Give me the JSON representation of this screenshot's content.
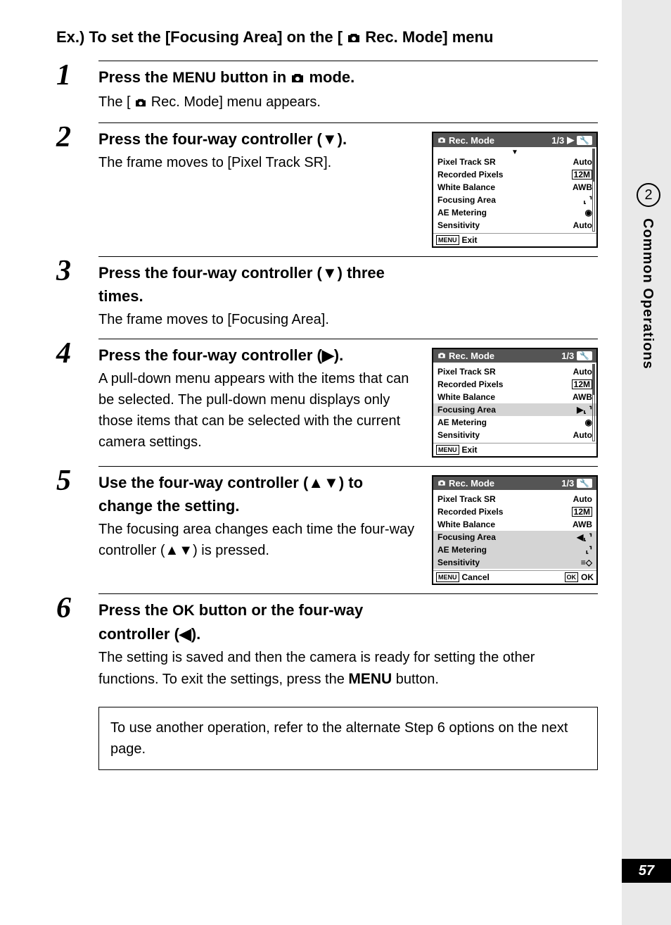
{
  "rail": {
    "chapter": "2",
    "title": "Common Operations",
    "page": "57"
  },
  "title": {
    "pre": "Ex.) To set the [Focusing Area] on the [",
    "post": " Rec. Mode] menu"
  },
  "steps": [
    {
      "num": "1",
      "head": {
        "a": "Press the ",
        "b": "MENU",
        "c": " button in ",
        "d": " mode."
      },
      "desc": {
        "a": "The [",
        "b": " Rec. Mode] menu appears."
      }
    },
    {
      "num": "2",
      "head": "Press the four-way controller (▼).",
      "desc": "The frame moves to [Pixel Track SR]."
    },
    {
      "num": "3",
      "head": "Press the four-way controller (▼) three times.",
      "desc": "The frame moves to [Focusing Area]."
    },
    {
      "num": "4",
      "head": "Press the four-way controller (▶).",
      "desc": "A pull-down menu appears with the items that can be selected.\nThe pull-down menu displays only those items that can be selected with the current camera settings."
    },
    {
      "num": "5",
      "head": "Use the four-way controller (▲▼) to change the setting.",
      "desc": "The focusing area changes each time the four-way controller (▲▼) is pressed."
    },
    {
      "num": "6",
      "head": {
        "a": "Press the ",
        "b": "OK",
        "c": " button or the four-way controller (◀)."
      },
      "desc": {
        "a": "The setting is saved and then the camera is ready for setting the other functions. To exit the settings, press the ",
        "b": "MENU",
        "c": " button."
      }
    }
  ],
  "lcd": {
    "title": "Rec. Mode",
    "page": "1/3",
    "menuLabel": "MENU",
    "okLabel": "OK",
    "footerExit": "Exit",
    "footerCancel": "Cancel",
    "footerOk": "OK",
    "rows": [
      {
        "label": "Pixel Track SR",
        "val": "Auto"
      },
      {
        "label": "Recorded Pixels",
        "val": "12M"
      },
      {
        "label": "White Balance",
        "val": "AWB"
      },
      {
        "label": "Focusing Area",
        "val": "[ ]"
      },
      {
        "label": "AE Metering",
        "val": "◉"
      },
      {
        "label": "Sensitivity",
        "val": "Auto"
      }
    ]
  },
  "note": "To use another operation, refer to the alternate Step 6 options on the next page."
}
